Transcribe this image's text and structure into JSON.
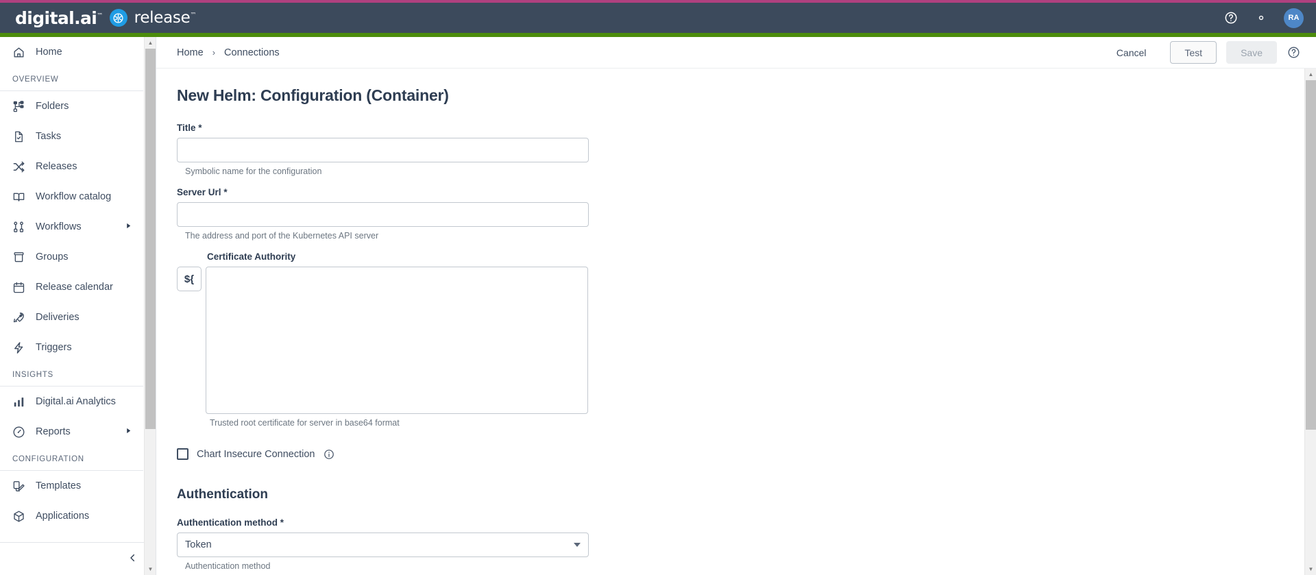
{
  "header": {
    "brand_primary": "digital.ai",
    "brand_tm": "™",
    "brand_product": "release",
    "brand_product_tm": "™",
    "help_icon": "help-circle-icon",
    "settings_icon": "gear-icon",
    "avatar_initials": "RA",
    "accent_top_color": "#b0417f",
    "header_bg_color": "#3c4a5c",
    "green_bar_color": "#4c8c0b",
    "avatar_color": "#4e87c7",
    "release_logo_color": "#1f9ce4"
  },
  "sidebar": {
    "home": {
      "label": "Home",
      "icon": "home-icon"
    },
    "sections": [
      {
        "title": "OVERVIEW",
        "items": [
          {
            "label": "Folders",
            "icon": "folders-icon",
            "has_caret": false
          },
          {
            "label": "Tasks",
            "icon": "task-document-icon",
            "has_caret": false
          },
          {
            "label": "Releases",
            "icon": "shuffle-icon",
            "has_caret": false
          },
          {
            "label": "Workflow catalog",
            "icon": "book-icon",
            "has_caret": false
          },
          {
            "label": "Workflows",
            "icon": "workflow-nodes-icon",
            "has_caret": true
          },
          {
            "label": "Groups",
            "icon": "box-stack-icon",
            "has_caret": false
          },
          {
            "label": "Release calendar",
            "icon": "calendar-icon",
            "has_caret": false
          },
          {
            "label": "Deliveries",
            "icon": "rocket-icon",
            "has_caret": false
          },
          {
            "label": "Triggers",
            "icon": "lightning-bolt-icon",
            "has_caret": false
          }
        ]
      },
      {
        "title": "INSIGHTS",
        "items": [
          {
            "label": "Digital.ai Analytics",
            "icon": "bar-chart-icon",
            "has_caret": false
          },
          {
            "label": "Reports",
            "icon": "gauge-icon",
            "has_caret": true
          }
        ]
      },
      {
        "title": "CONFIGURATION",
        "items": [
          {
            "label": "Templates",
            "icon": "templates-icon",
            "has_caret": false
          },
          {
            "label": "Applications",
            "icon": "package-cube-icon",
            "has_caret": false
          }
        ]
      }
    ],
    "collapse_icon": "chevron-left-icon",
    "scroll_up_icon": "scroll-up-arrow-icon",
    "scroll_down_icon": "scroll-down-arrow-icon"
  },
  "toolbar": {
    "breadcrumb": [
      "Home",
      "Connections"
    ],
    "breadcrumb_separator": "›",
    "cancel_label": "Cancel",
    "test_label": "Test",
    "save_label": "Save",
    "help_icon": "help-circle-icon"
  },
  "form": {
    "page_title": "New Helm: Configuration (Container)",
    "title_field": {
      "label": "Title",
      "required_marker": "*",
      "value": "",
      "placeholder": "",
      "hint": "Symbolic name for the configuration"
    },
    "server_url_field": {
      "label": "Server Url",
      "required_marker": "*",
      "value": "",
      "placeholder": "",
      "hint": "The address and port of the Kubernetes API server"
    },
    "certificate_authority": {
      "label": "Certificate Authority",
      "variable_button_label": "${",
      "value": "",
      "placeholder": "",
      "hint": "Trusted root certificate for server in base64 format"
    },
    "chart_insecure_connection": {
      "label": "Chart Insecure Connection",
      "checked": false,
      "info_icon": "info-circle-icon"
    },
    "authentication": {
      "section_title": "Authentication",
      "method_field": {
        "label": "Authentication method",
        "required_marker": "*",
        "value": "Token",
        "hint": "Authentication method",
        "options": [
          "Token"
        ],
        "caret_icon": "chevron-down-icon"
      }
    }
  }
}
